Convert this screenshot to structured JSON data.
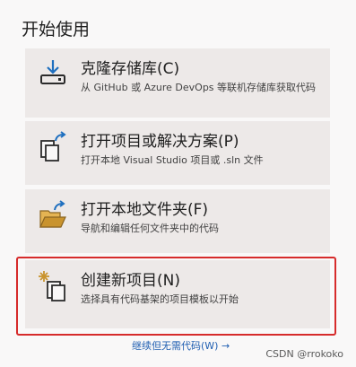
{
  "heading": "开始使用",
  "cards": {
    "clone": {
      "icon": "clone-download-icon",
      "title": "克隆存储库(C)",
      "description": "从 GitHub 或 Azure DevOps 等联机存储库获取代码"
    },
    "open_project": {
      "icon": "open-project-icon",
      "title": "打开项目或解决方案(P)",
      "description": "打开本地 Visual Studio 项目或 .sln 文件"
    },
    "open_folder": {
      "icon": "folder-open-icon",
      "title": "打开本地文件夹(F)",
      "description": "导航和编辑任何文件夹中的代码"
    },
    "new_project": {
      "icon": "new-project-icon",
      "title": "创建新项目(N)",
      "description": "选择具有代码基架的项目模板以开始"
    }
  },
  "continue_link": "继续但无需代码(W) →",
  "watermark": "CSDN @rrokoko",
  "colors": {
    "card_bg": "#ede9e8",
    "highlight": "#d62b2b",
    "link": "#1f5eb1",
    "accent_blue": "#1f6fbf",
    "folder": "#c9932e"
  }
}
